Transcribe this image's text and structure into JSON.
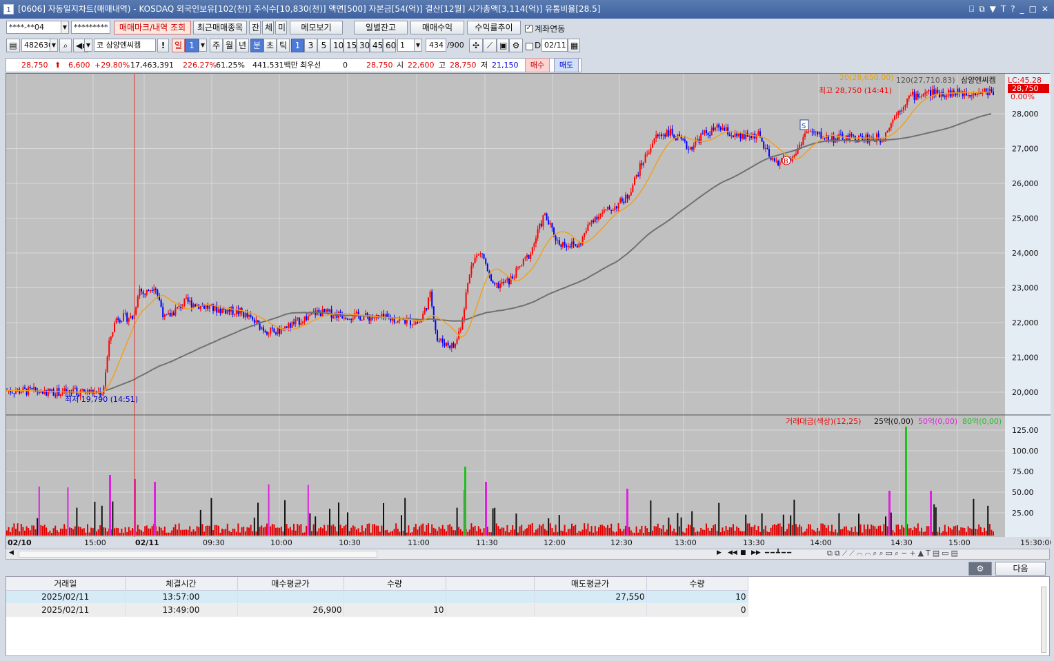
{
  "window": {
    "title": "[0606] 자동일지차트(매매내역) - KOSDAQ 외국인보유[102(천)] 주식수[10,830(천)] 액면[500] 자본금[54(억)] 결산[12월] 시가총액[3,114(억)] 유통비율[28.5]",
    "app_icon": "1",
    "buttons": [
      "⍈",
      "⧉",
      "▼",
      "T",
      "?",
      "_",
      "□",
      "✕"
    ]
  },
  "toolbar1": {
    "account": "****-**04",
    "password": "*********",
    "btn_mark": "매매마크/내역 조회",
    "btn_recent": "최근매매종목",
    "btn_jan": "잔",
    "btn_che": "체",
    "btn_mi": "미",
    "btn_memo": "메모보기",
    "btn_daily": "일별잔고",
    "btn_profit": "매매수익",
    "btn_rate": "수익률추이",
    "link_label": "계좌연동",
    "link_checked": "✓"
  },
  "toolbar2": {
    "code": "482630",
    "name_prefix": "코",
    "name": "삼양엔씨켐",
    "alert": "!",
    "period_day": "일",
    "day_num": "1",
    "week": "주",
    "month": "월",
    "year": "년",
    "minute": "분",
    "second": "초",
    "tick": "틱",
    "minutes": [
      "1",
      "3",
      "5",
      "10",
      "15",
      "30",
      "45",
      "60"
    ],
    "interval": "1",
    "count": "434",
    "count_max": "/900",
    "d_label": "D",
    "date": "02/11"
  },
  "quote": {
    "price": "28,750",
    "arrow": "⬆",
    "change": "6,600",
    "change_pct": "+29.80%",
    "volume": "17,463,391",
    "vol_ratio": "226.27%",
    "turnover": "61.25%",
    "amount": "441,531백만",
    "pref_label": "최우선",
    "pref_qty": "0",
    "pref_price": "28,750",
    "open_label": "시",
    "open": "22,600",
    "high_label": "고",
    "high": "28,750",
    "low_label": "저",
    "low": "21,150",
    "buy": "매수",
    "sell": "매도"
  },
  "chart": {
    "legend_ma": "20(28,650.00)",
    "legend_ma2": "120(27,710.83)",
    "legend_name": "삼양엔씨켐",
    "lc": "LC:45.28",
    "price_tag": "28,750",
    "pct_tag": "0.00%",
    "high_note": "최고 28,750 (14:41)",
    "low_note": "최저 19,790 (14:51)",
    "price_axis": [
      "28,000",
      "27,000",
      "26,000",
      "25,000",
      "24,000",
      "23,000",
      "22,000",
      "21,000",
      "20,000"
    ],
    "vol_legend": [
      "거래대금(색상)(12,25)",
      "25억(0,00)",
      "50억(0,00)",
      "80억(0,00)"
    ],
    "vol_axis": [
      "125.00",
      "100.00",
      "75.00",
      "50.00",
      "25.00"
    ],
    "time_axis": [
      "02/10",
      "15:00",
      "02/11",
      "09:30",
      "10:00",
      "10:30",
      "11:00",
      "11:30",
      "12:00",
      "12:30",
      "13:00",
      "13:30",
      "14:00",
      "14:30",
      "15:00",
      "15:30:00"
    ],
    "marker_s": "S",
    "marker_b": "B"
  },
  "chart_data": {
    "type": "candlestick",
    "title": "",
    "colors": {
      "up": "#ff0000",
      "down": "#0000ff",
      "ma20": "#f0a020",
      "ma120": "#707070"
    },
    "ma20_last": 28650,
    "ma120_last": 27710.83,
    "price_range": [
      19500,
      28900
    ],
    "high": 28750,
    "low": 19790
  },
  "buttons_bottom": {
    "gear": "⚙",
    "next": "다음"
  },
  "table": {
    "headers": [
      "거래일",
      "체결시간",
      "매수평균가",
      "수량",
      "",
      "매도평균가",
      "수량"
    ],
    "rows": [
      [
        "2025/02/11",
        "13:57:00",
        "",
        "",
        "",
        "27,550",
        "10"
      ],
      [
        "2025/02/11",
        "13:49:00",
        "26,900",
        "10",
        "",
        "",
        "0"
      ]
    ]
  }
}
